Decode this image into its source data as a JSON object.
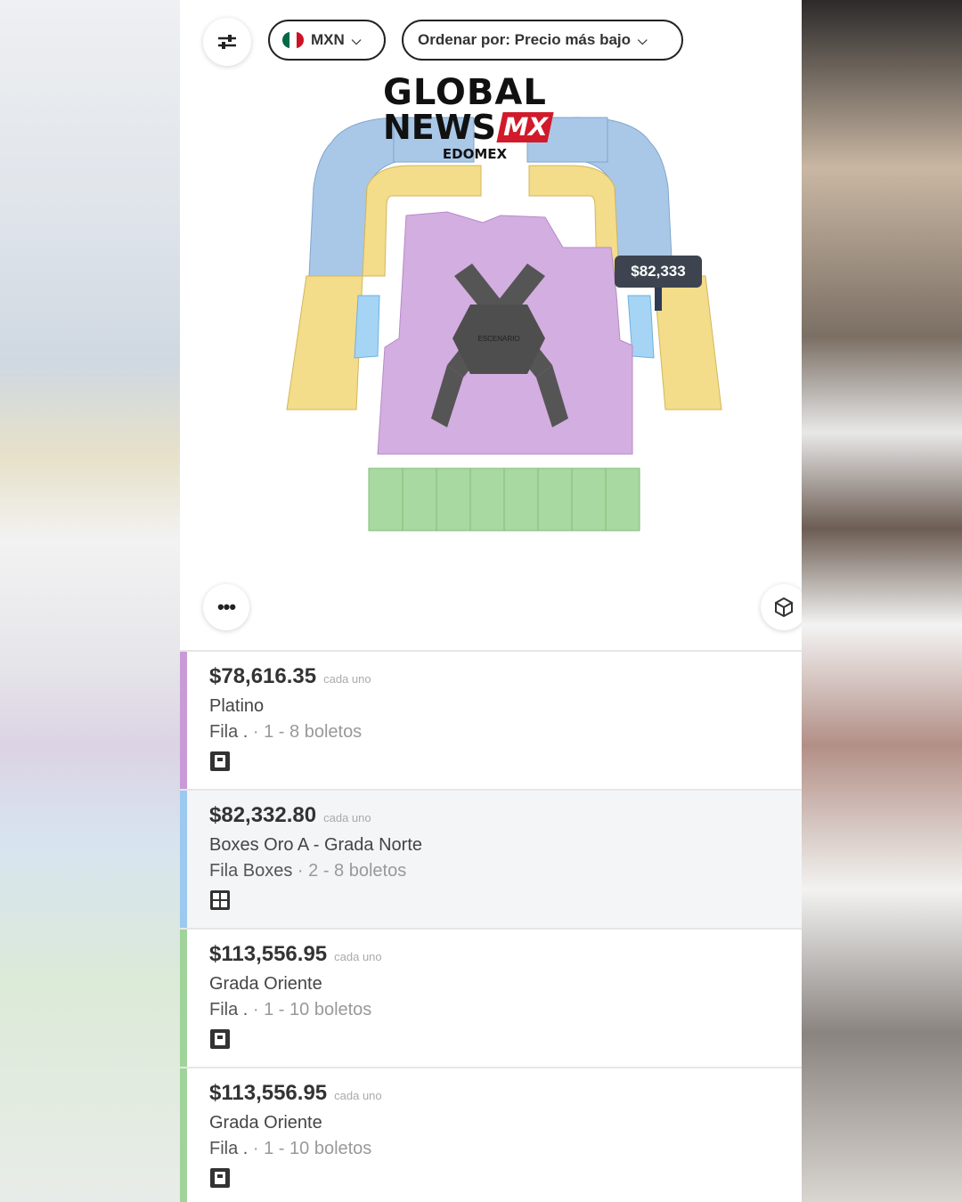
{
  "toolbar": {
    "filter_icon": "sliders-icon",
    "currency": "MXN",
    "currency_flag_colors": [
      "#006847",
      "#ffffff",
      "#ce1126"
    ],
    "sort_label": "Ordenar por: Precio más bajo"
  },
  "watermark": {
    "line1": "GLOBAL",
    "line2": "NEWS",
    "line2_badge": "MX",
    "line3": "EDOMEX"
  },
  "map": {
    "price_tag": "$82,333",
    "stage_label": "ESCENARIO",
    "section_colors": {
      "blue": "#a9c8e8",
      "yellow": "#f3dc8a",
      "purple": "#d3aee0",
      "light_blue": "#a6d4f5",
      "green": "#a8d9a0",
      "stage": "#555555"
    }
  },
  "controls": {
    "more_label": "•••",
    "more_icon": "ellipsis-icon",
    "view_icon": "cube-icon"
  },
  "listings": [
    {
      "price": "$78,616.35",
      "unit": "cada uno",
      "section": "Platino",
      "row": "Fila .",
      "detail": " · 1 - 8 boletos",
      "color": "#c99bd6",
      "icon": "mobile-ticket-icon"
    },
    {
      "price": "$82,332.80",
      "unit": "cada uno",
      "section": "Boxes Oro A - Grada Norte",
      "row": "Fila Boxes",
      "detail": " · 2 - 8 boletos",
      "color": "#9cc9f0",
      "icon": "qr-ticket-icon"
    },
    {
      "price": "$113,556.95",
      "unit": "cada uno",
      "section": "Grada Oriente",
      "row": "Fila .",
      "detail": " · 1 - 10 boletos",
      "color": "#9fd39a",
      "icon": "mobile-ticket-icon"
    },
    {
      "price": "$113,556.95",
      "unit": "cada uno",
      "section": "Grada Oriente",
      "row": "Fila .",
      "detail": " · 1 - 10 boletos",
      "color": "#9fd39a",
      "icon": "mobile-ticket-icon"
    }
  ]
}
